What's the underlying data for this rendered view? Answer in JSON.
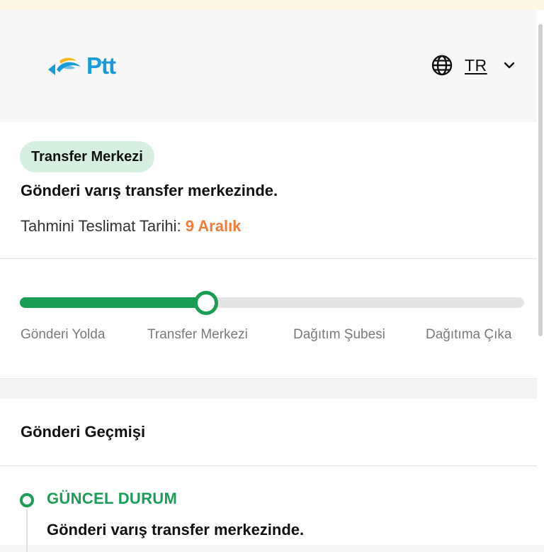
{
  "header": {
    "logo_text": "Ptt",
    "language": {
      "icon": "globe-icon",
      "code": "TR",
      "dropdown_icon": "chevron-down-icon"
    }
  },
  "status": {
    "badge": "Transfer Merkezi",
    "title": "Gönderi varış transfer merkezinde.",
    "eta_label": "Tahmini Teslimat Tarihi:",
    "eta_date": "9 Aralık"
  },
  "progress": {
    "current_step_index": 1,
    "fraction_complete": 0.37,
    "steps": [
      {
        "label": "Gönderi Yolda"
      },
      {
        "label": "Transfer Merkezi"
      },
      {
        "label": "Dağıtım Şubesi"
      },
      {
        "label": "Dağıtıma Çıka"
      }
    ]
  },
  "history": {
    "title": "Gönderi Geçmişi",
    "current": {
      "label": "GÜNCEL DURUM",
      "description": "Gönderi varış transfer merkezinde."
    }
  },
  "colors": {
    "accent_green": "#1a9e55",
    "badge_bg": "#d6efe0",
    "eta_orange": "#f07c3a",
    "logo_blue": "#1a9bd7"
  }
}
